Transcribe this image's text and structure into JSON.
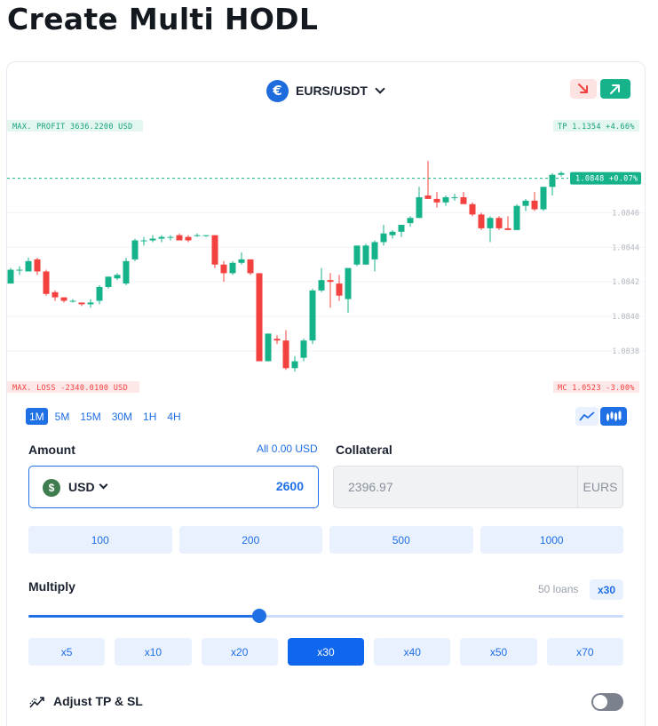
{
  "page": {
    "title": "Create Multi HODL"
  },
  "pair": {
    "name": "EURS/USDT",
    "logo_glyph": "€"
  },
  "direction": {
    "down_icon": "arrow-down-right-icon",
    "up_icon": "arrow-up-right-icon"
  },
  "chart": {
    "max_profit": "MAX. PROFIT 3636.2200 USD",
    "max_loss": "MAX. LOSS -2340.0100 USD",
    "tp": "TP 1.1354 +4.66%",
    "mc": "MC 1.0523 -3.00%",
    "current": "1.0848 +0.07%",
    "y_ticks": [
      "1.0846",
      "1.0844",
      "1.0842",
      "1.0840",
      "1.0838"
    ],
    "colors": {
      "up": "#16b38b",
      "down": "#f2413e"
    }
  },
  "chart_data": {
    "type": "candlestick",
    "ylim": [
      1.08365,
      1.08505
    ],
    "y_ticks": [
      1.0846,
      1.0844,
      1.0842,
      1.084,
      1.0838
    ],
    "current_price": 1.0848,
    "candles": [
      {
        "o": 1.08419,
        "h": 1.08428,
        "l": 1.08419,
        "c": 1.08427
      },
      {
        "o": 1.08427,
        "h": 1.08429,
        "l": 1.08424,
        "c": 1.08427
      },
      {
        "o": 1.08426,
        "h": 1.08434,
        "l": 1.08426,
        "c": 1.08432
      },
      {
        "o": 1.08433,
        "h": 1.08434,
        "l": 1.08424,
        "c": 1.08426
      },
      {
        "o": 1.08426,
        "h": 1.08427,
        "l": 1.08412,
        "c": 1.08413
      },
      {
        "o": 1.08414,
        "h": 1.08415,
        "l": 1.08409,
        "c": 1.08411
      },
      {
        "o": 1.08411,
        "h": 1.08411,
        "l": 1.08408,
        "c": 1.08409
      },
      {
        "o": 1.08409,
        "h": 1.0841,
        "l": 1.08408,
        "c": 1.08409
      },
      {
        "o": 1.08408,
        "h": 1.08408,
        "l": 1.08406,
        "c": 1.08407
      },
      {
        "o": 1.08407,
        "h": 1.0841,
        "l": 1.08405,
        "c": 1.08408
      },
      {
        "o": 1.08409,
        "h": 1.08418,
        "l": 1.08407,
        "c": 1.08417
      },
      {
        "o": 1.08417,
        "h": 1.08423,
        "l": 1.08416,
        "c": 1.08423
      },
      {
        "o": 1.08422,
        "h": 1.08425,
        "l": 1.08421,
        "c": 1.08424
      },
      {
        "o": 1.08419,
        "h": 1.08434,
        "l": 1.08418,
        "c": 1.08432
      },
      {
        "o": 1.08433,
        "h": 1.08445,
        "l": 1.08432,
        "c": 1.08444
      },
      {
        "o": 1.08444,
        "h": 1.08446,
        "l": 1.08441,
        "c": 1.08444
      },
      {
        "o": 1.08444,
        "h": 1.08447,
        "l": 1.08443,
        "c": 1.08445
      },
      {
        "o": 1.08445,
        "h": 1.08447,
        "l": 1.08443,
        "c": 1.08446
      },
      {
        "o": 1.08446,
        "h": 1.08447,
        "l": 1.08444,
        "c": 1.08446
      },
      {
        "o": 1.08447,
        "h": 1.08448,
        "l": 1.08444,
        "c": 1.08444
      },
      {
        "o": 1.08446,
        "h": 1.08447,
        "l": 1.08443,
        "c": 1.08444
      },
      {
        "o": 1.08447,
        "h": 1.08448,
        "l": 1.08446,
        "c": 1.08447
      },
      {
        "o": 1.08447,
        "h": 1.08447,
        "l": 1.08446,
        "c": 1.08447
      },
      {
        "o": 1.08447,
        "h": 1.08447,
        "l": 1.08428,
        "c": 1.0843
      },
      {
        "o": 1.0843,
        "h": 1.08432,
        "l": 1.0842,
        "c": 1.08425
      },
      {
        "o": 1.08425,
        "h": 1.08432,
        "l": 1.08424,
        "c": 1.08431
      },
      {
        "o": 1.08431,
        "h": 1.08437,
        "l": 1.0843,
        "c": 1.08433
      },
      {
        "o": 1.08433,
        "h": 1.08433,
        "l": 1.08424,
        "c": 1.08425
      },
      {
        "o": 1.08425,
        "h": 1.08425,
        "l": 1.08374,
        "c": 1.08374
      },
      {
        "o": 1.08374,
        "h": 1.0839,
        "l": 1.08374,
        "c": 1.0839
      },
      {
        "o": 1.08387,
        "h": 1.08389,
        "l": 1.08384,
        "c": 1.08386
      },
      {
        "o": 1.08386,
        "h": 1.08392,
        "l": 1.08369,
        "c": 1.0837
      },
      {
        "o": 1.0837,
        "h": 1.08377,
        "l": 1.08368,
        "c": 1.08374
      },
      {
        "o": 1.08376,
        "h": 1.08387,
        "l": 1.08374,
        "c": 1.08386
      },
      {
        "o": 1.08386,
        "h": 1.08416,
        "l": 1.08384,
        "c": 1.08415
      },
      {
        "o": 1.08415,
        "h": 1.08428,
        "l": 1.08414,
        "c": 1.08421
      },
      {
        "o": 1.08421,
        "h": 1.08425,
        "l": 1.08405,
        "c": 1.0842
      },
      {
        "o": 1.08419,
        "h": 1.08424,
        "l": 1.08409,
        "c": 1.08412
      },
      {
        "o": 1.0841,
        "h": 1.08426,
        "l": 1.08402,
        "c": 1.08428
      },
      {
        "o": 1.0843,
        "h": 1.08441,
        "l": 1.08429,
        "c": 1.08441
      },
      {
        "o": 1.0843,
        "h": 1.08442,
        "l": 1.0843,
        "c": 1.08441
      },
      {
        "o": 1.08433,
        "h": 1.08444,
        "l": 1.08426,
        "c": 1.08443
      },
      {
        "o": 1.08443,
        "h": 1.08453,
        "l": 1.08441,
        "c": 1.08448
      },
      {
        "o": 1.08447,
        "h": 1.0845,
        "l": 1.08445,
        "c": 1.08449
      },
      {
        "o": 1.08449,
        "h": 1.08451,
        "l": 1.08446,
        "c": 1.08453
      },
      {
        "o": 1.08454,
        "h": 1.08458,
        "l": 1.08452,
        "c": 1.08457
      },
      {
        "o": 1.08457,
        "h": 1.08475,
        "l": 1.08457,
        "c": 1.08469
      },
      {
        "o": 1.0847,
        "h": 1.0849,
        "l": 1.08469,
        "c": 1.08468
      },
      {
        "o": 1.08468,
        "h": 1.08472,
        "l": 1.08463,
        "c": 1.08466
      },
      {
        "o": 1.08466,
        "h": 1.0847,
        "l": 1.08464,
        "c": 1.08469
      },
      {
        "o": 1.08469,
        "h": 1.08471,
        "l": 1.08467,
        "c": 1.08469
      },
      {
        "o": 1.08469,
        "h": 1.08472,
        "l": 1.08467,
        "c": 1.08465
      },
      {
        "o": 1.08465,
        "h": 1.08466,
        "l": 1.08458,
        "c": 1.08459
      },
      {
        "o": 1.08459,
        "h": 1.0846,
        "l": 1.0845,
        "c": 1.08451
      },
      {
        "o": 1.08451,
        "h": 1.08458,
        "l": 1.08443,
        "c": 1.08457
      },
      {
        "o": 1.08457,
        "h": 1.08458,
        "l": 1.0845,
        "c": 1.08451
      },
      {
        "o": 1.08451,
        "h": 1.08458,
        "l": 1.0845,
        "c": 1.0845
      },
      {
        "o": 1.0845,
        "h": 1.08465,
        "l": 1.0845,
        "c": 1.08464
      },
      {
        "o": 1.08464,
        "h": 1.08468,
        "l": 1.08461,
        "c": 1.08467
      },
      {
        "o": 1.08467,
        "h": 1.08472,
        "l": 1.08461,
        "c": 1.08462
      },
      {
        "o": 1.08462,
        "h": 1.08475,
        "l": 1.08461,
        "c": 1.08475
      },
      {
        "o": 1.08475,
        "h": 1.08483,
        "l": 1.0847,
        "c": 1.08482
      },
      {
        "o": 1.08482,
        "h": 1.08484,
        "l": 1.08481,
        "c": 1.08483
      }
    ]
  },
  "timeframes": [
    "1M",
    "5M",
    "15M",
    "30M",
    "1H",
    "4H"
  ],
  "timeframe_active": 0,
  "chart_type_icons": {
    "line": "line-chart-icon",
    "candles": "candlestick-chart-icon"
  },
  "amount": {
    "label": "Amount",
    "all_prefix": "All",
    "all_value": "0.00 USD",
    "currency": "USD",
    "currency_icon": "$",
    "value": "2600",
    "presets": [
      "100",
      "200",
      "500",
      "1000"
    ]
  },
  "collateral": {
    "label": "Collateral",
    "value": "2396.97",
    "currency": "EURS"
  },
  "multiply": {
    "label": "Multiply",
    "loans": "50 loans",
    "selected": "x30",
    "slider_fraction": 0.388,
    "options": [
      "x5",
      "x10",
      "x20",
      "x30",
      "x40",
      "x50",
      "x70"
    ],
    "active_index": 3
  },
  "adjust": {
    "label": "Adjust TP & SL",
    "enabled": false,
    "icon": "trend-icon"
  }
}
